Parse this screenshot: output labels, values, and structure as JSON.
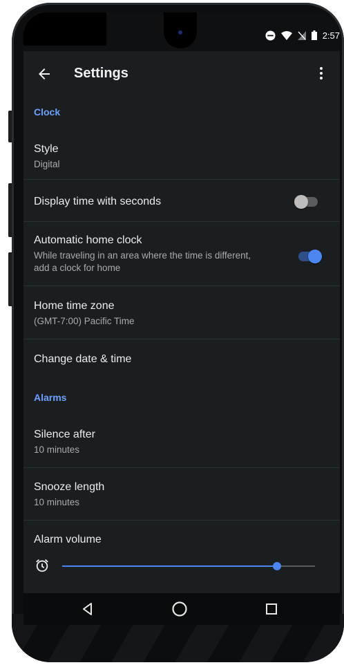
{
  "status": {
    "time": "2:57"
  },
  "appbar": {
    "title": "Settings"
  },
  "sections": {
    "clock": "Clock",
    "alarms": "Alarms"
  },
  "items": {
    "style": {
      "title": "Style",
      "summary": "Digital"
    },
    "seconds": {
      "title": "Display time with seconds",
      "enabled": false
    },
    "auto_home": {
      "title": "Automatic home clock",
      "summary_line1": "While traveling in an area where the time is different,",
      "summary_line2": "add a clock for home",
      "enabled": true
    },
    "home_tz": {
      "title": "Home time zone",
      "summary": "(GMT-7:00) Pacific Time"
    },
    "change_dt": {
      "title": "Change date & time"
    },
    "silence": {
      "title": "Silence after",
      "summary": "10 minutes"
    },
    "snooze": {
      "title": "Snooze length",
      "summary": "10 minutes"
    },
    "alarm_volume": {
      "title": "Alarm volume",
      "level": 0.85
    }
  },
  "colors": {
    "accent": "#6ea1ff",
    "switch_on_knob": "#4c86f0",
    "switch_on_track": "#2f4f8a",
    "switch_off_knob": "#bdbdbd",
    "switch_off_track": "#5a5d60"
  },
  "icons": {
    "back": "arrow-left-icon",
    "more": "more-vert-icon",
    "alarm": "alarm-clock-icon",
    "nav_back": "triangle-back-icon",
    "nav_home": "circle-home-icon",
    "nav_recents": "square-recents-icon"
  }
}
